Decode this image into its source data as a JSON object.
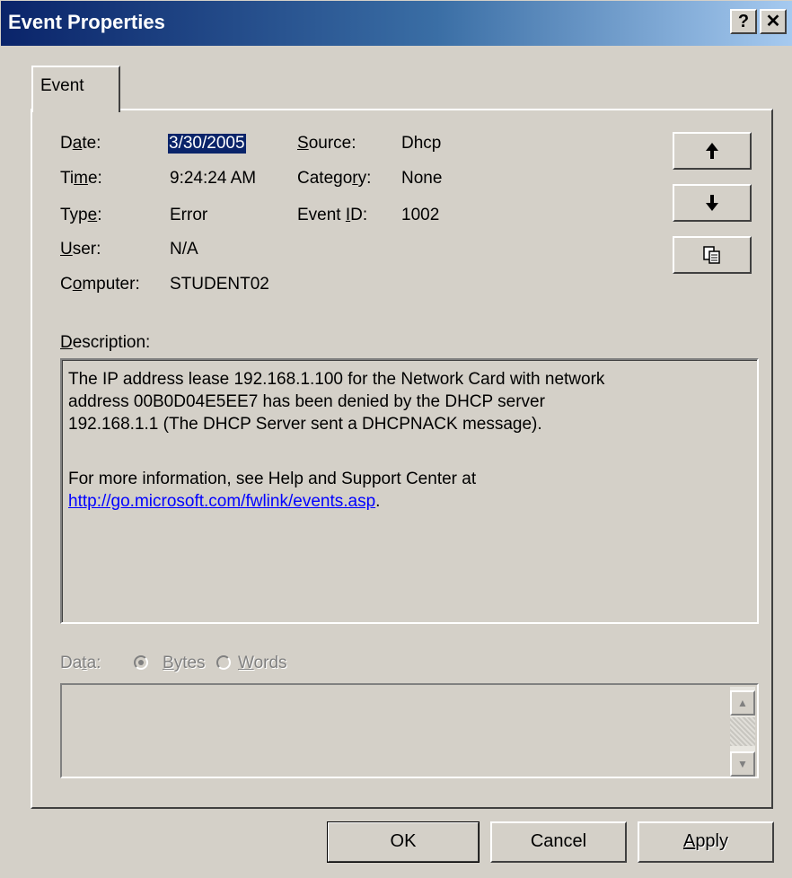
{
  "window": {
    "title": "Event Properties",
    "help_label": "?",
    "close_label": "✕"
  },
  "tab": {
    "label": "Event"
  },
  "fields": {
    "date_label": "Date:",
    "date_value": "3/30/2005",
    "time_label": "Time:",
    "time_value": "9:24:24 AM",
    "type_label": "Type:",
    "type_value": "Error",
    "user_label": "User:",
    "user_value": "N/A",
    "computer_label": "Computer:",
    "computer_value": "STUDENT02",
    "source_label": "Source:",
    "source_value": "Dhcp",
    "category_label": "Category:",
    "category_value": "None",
    "eventid_label": "Event ID:",
    "eventid_value": "1002"
  },
  "side_buttons": {
    "up": "🡑",
    "down": "🡓",
    "copy": "⎘"
  },
  "description": {
    "label": "Description:",
    "line1": "The IP address lease 192.168.1.100 for the Network Card with network",
    "line2": "address 00B0D04E5EE7 has been denied by the DHCP server",
    "line3": "192.168.1.1 (The DHCP Server sent a DHCPNACK message).",
    "line4": "For more information, see Help and Support Center at",
    "link": "http://go.microsoft.com/fwlink/events.asp",
    "link_suffix": "."
  },
  "data": {
    "label": "Data:",
    "bytes_label": "Bytes",
    "words_label": "Words"
  },
  "buttons": {
    "ok": "OK",
    "cancel": "Cancel",
    "apply": "Apply"
  },
  "colors": {
    "titlebar_start": "#0a246a",
    "titlebar_end": "#a6caf0",
    "face": "#d4d0c8",
    "link": "#0000ff"
  }
}
